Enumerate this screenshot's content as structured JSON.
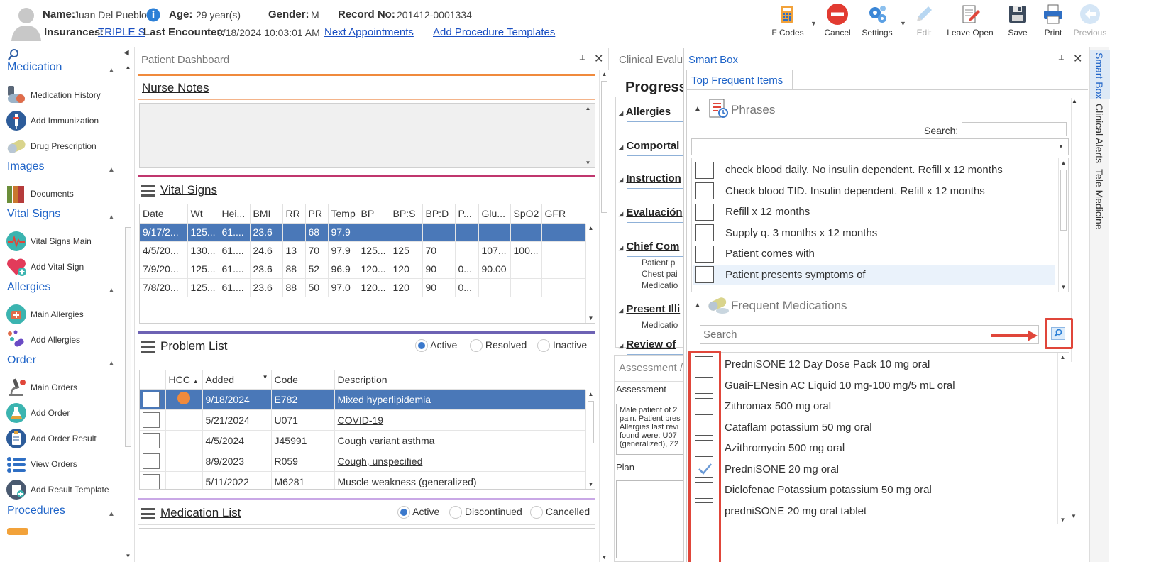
{
  "header": {
    "name_label": "Name:",
    "name": "Juan Del Pueblo",
    "age_label": "Age:",
    "age": "29 year(s)",
    "gender_label": "Gender:",
    "gender": "M",
    "record_label": "Record No:",
    "record": "201412-0001334",
    "insurances_label": "Insurances:",
    "insurance": "TRIPLE S",
    "last_enc_label": "Last Encounter:",
    "last_encounter": "9/18/2024 10:03:01 AM",
    "next_appointments": "Next Appointments",
    "add_procedure_templates": "Add Procedure Templates"
  },
  "toolbar": {
    "fcodes": "F Codes",
    "cancel": "Cancel",
    "settings": "Settings",
    "edit": "Edit",
    "leave_open": "Leave Open",
    "save": "Save",
    "print": "Print",
    "previous": "Previous"
  },
  "sidebar": {
    "sections": [
      {
        "title": "Medication",
        "items": [
          "Medication History",
          "Add Immunization",
          "Drug Prescription"
        ]
      },
      {
        "title": "Images",
        "items": [
          "Documents"
        ]
      },
      {
        "title": "Vital Signs",
        "items": [
          "Vital Signs Main",
          "Add Vital Sign"
        ]
      },
      {
        "title": "Allergies",
        "items": [
          "Main Allergies",
          "Add Allergies"
        ]
      },
      {
        "title": "Order",
        "items": [
          "Main Orders",
          "Add Order",
          "Add Order Result",
          "View Orders",
          "Add Result Template"
        ]
      },
      {
        "title": "Procedures",
        "items": []
      }
    ]
  },
  "dashboard": {
    "title": "Patient Dashboard",
    "nurse_notes": "Nurse Notes",
    "vital_signs": "Vital Signs",
    "vitals_columns": [
      "Date",
      "Wt",
      "Hei...",
      "BMI",
      "RR",
      "PR",
      "Temp",
      "BP",
      "BP:S",
      "BP:D",
      "P...",
      "Glu...",
      "SpO2",
      "GFR"
    ],
    "vitals_rows": [
      [
        "9/17/2...",
        "125...",
        "61....",
        "23.6",
        "",
        "68",
        "97.9",
        "",
        "",
        "",
        "",
        "",
        "",
        ""
      ],
      [
        "4/5/20...",
        "130...",
        "61....",
        "24.6",
        "13",
        "70",
        "97.9",
        "125...",
        "125",
        "70",
        "",
        "107...",
        "100...",
        ""
      ],
      [
        "7/9/20...",
        "125...",
        "61....",
        "23.6",
        "88",
        "52",
        "96.9",
        "120...",
        "120",
        "90",
        "0...",
        "90.00",
        "",
        ""
      ],
      [
        "7/8/20...",
        "125...",
        "61....",
        "23.6",
        "88",
        "50",
        "97.0",
        "120...",
        "120",
        "90",
        "0...",
        "",
        "",
        ""
      ]
    ],
    "problem_list": "Problem List",
    "problem_radios": [
      "Active",
      "Resolved",
      "Inactive"
    ],
    "problem_columns": [
      "HCC",
      "Added",
      "Code",
      "Description"
    ],
    "problem_rows": [
      {
        "added": "9/18/2024",
        "code": "E782",
        "desc": "Mixed hyperlipidemia",
        "link": false
      },
      {
        "added": "5/21/2024",
        "code": "U071",
        "desc": "COVID-19",
        "link": true
      },
      {
        "added": "4/5/2024",
        "code": "J45991",
        "desc": "Cough variant asthma",
        "link": false
      },
      {
        "added": "8/9/2023",
        "code": "R059",
        "desc": "Cough, unspecified",
        "link": true
      },
      {
        "added": "5/11/2022",
        "code": "M6281",
        "desc": "Muscle weakness (generalized)",
        "link": false
      }
    ],
    "medication_list": "Medication List",
    "medication_radios": [
      "Active",
      "Discontinued",
      "Cancelled"
    ]
  },
  "clinical": {
    "title": "Clinical Evalu",
    "progress": "Progress",
    "sections": [
      "Allergies",
      "Comportal",
      "Instruction",
      "Evaluación",
      "Chief Com",
      "Present Illi",
      "Review of"
    ],
    "chief_sub": [
      "Patient p",
      "Chest pai",
      "Medicatio"
    ],
    "present_sub": "Medicatio",
    "assessment_title": "Assessment /",
    "assessment_label": "Assessment",
    "assessment_text": [
      "Male patient of 2",
      "pain. Patient pres",
      "Allergies last revi",
      "found were:  U07",
      "(generalized), Z2"
    ],
    "plan_label": "Plan"
  },
  "smartbox": {
    "title": "Smart Box",
    "tab": "Top Frequent Items",
    "phrases_title": "Phrases",
    "search_label": "Search:",
    "phrases": [
      "check blood daily. No insulin dependent. Refill x 12 months",
      "Check blood TID. Insulin dependent. Refill x 12 months",
      "Refill x 12 months",
      "Supply q. 3 months x 12 months",
      "Patient comes with",
      "Patient presents symptoms of"
    ],
    "meds_title": "Frequent Medications",
    "meds_search_placeholder": "Search",
    "medications": [
      {
        "name": "PredniSONE 12 Day Dose Pack 10 mg oral",
        "checked": false
      },
      {
        "name": "GuaiFENesin AC Liquid 10 mg-100 mg/5 mL oral",
        "checked": false
      },
      {
        "name": "Zithromax 500 mg oral",
        "checked": false
      },
      {
        "name": "Cataflam potassium 50 mg oral",
        "checked": false
      },
      {
        "name": "Azithromycin 500 mg oral",
        "checked": false
      },
      {
        "name": "PredniSONE 20 mg oral",
        "checked": true
      },
      {
        "name": "Diclofenac Potassium potassium 50 mg oral",
        "checked": false
      },
      {
        "name": "predniSONE 20 mg oral tablet",
        "checked": false
      }
    ]
  },
  "right_tabs": [
    "Smart Box",
    "Clinical Alerts",
    "Tele Medicine"
  ],
  "colors": {
    "accent": "#1f64c8",
    "selected_row": "#4a78b8",
    "highlight": "#e0463a"
  }
}
